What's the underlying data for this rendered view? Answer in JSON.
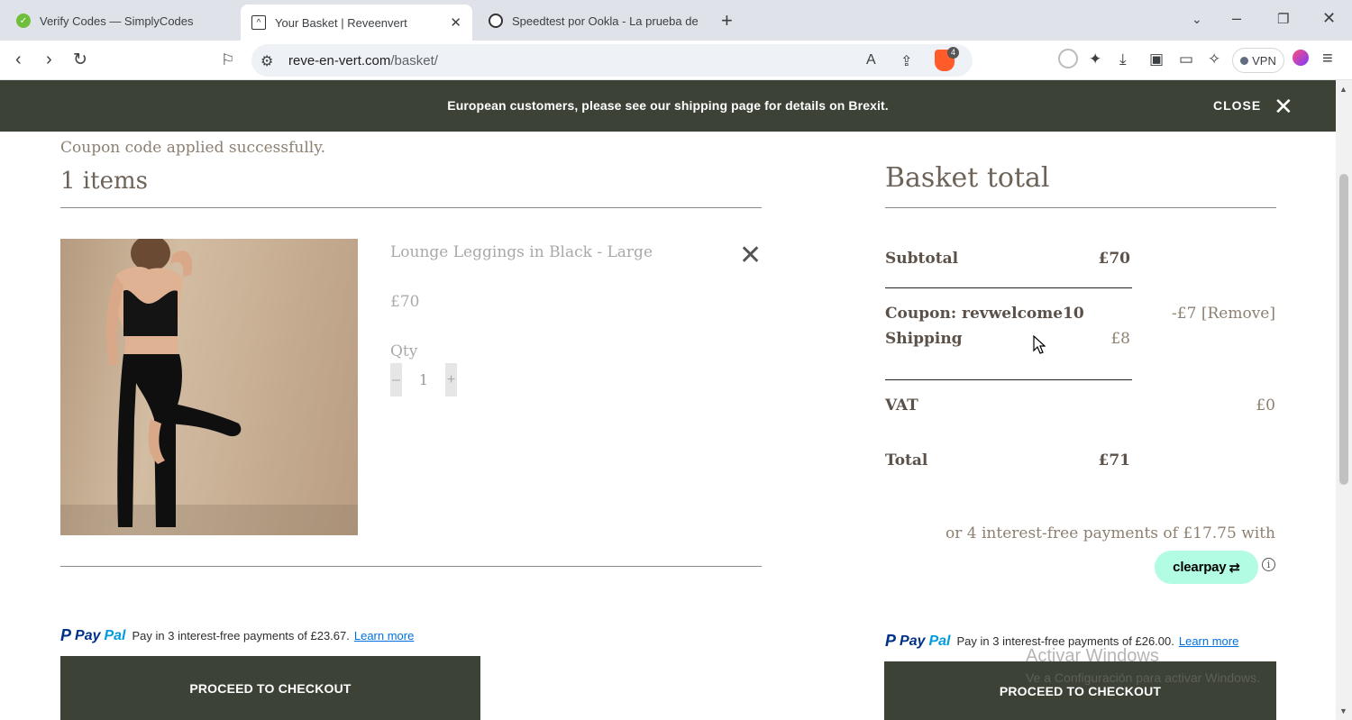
{
  "browser": {
    "tabs": [
      {
        "title": "Verify Codes — SimplyCodes",
        "icon": "simplycodes-favicon"
      },
      {
        "title": "Your Basket | Reveenvert",
        "icon": "reveenvert-favicon",
        "close": "✕"
      },
      {
        "title": "Speedtest por Ookla - La prueba de",
        "icon": "ookla-favicon"
      }
    ],
    "url_host": "reve-en-vert.com",
    "url_path": "/basket/",
    "extension_badge": "4",
    "vpn_label": "VPN"
  },
  "banner": {
    "message": "European customers, please see our shipping page for details on Brexit.",
    "close_label": "CLOSE"
  },
  "basket": {
    "coupon_message": "Coupon code applied successfully.",
    "items_count": "1 items",
    "item": {
      "name": "Lounge Leggings in Black - Large",
      "price": "£70",
      "qty_label": "Qty",
      "qty_minus": "–",
      "qty_value": "1",
      "qty_plus": "+"
    },
    "paypal_left": {
      "text": "Pay in 3 interest-free payments of £23.67.",
      "learn": "Learn more"
    },
    "checkout_label": "PROCEED TO CHECKOUT"
  },
  "summary": {
    "title": "Basket total",
    "subtotal_label": "Subtotal",
    "subtotal_value": "£70",
    "coupon_label": "Coupon: revwelcome10",
    "coupon_value": "-£7",
    "coupon_remove": "[Remove]",
    "shipping_label": "Shipping",
    "shipping_value": "£8",
    "vat_label": "VAT",
    "vat_value": "£0",
    "total_label": "Total",
    "total_value": "£71",
    "clearpay_text": "or 4 interest-free payments of £17.75 with",
    "clearpay_brand": "clearpay",
    "paypal_right": {
      "text": "Pay in 3 interest-free payments of £26.00.",
      "learn": "Learn more"
    },
    "checkout_label": "PROCEED TO CHECKOUT"
  },
  "paypal_brand": {
    "pay": "Pay",
    "pal": "Pal"
  },
  "watermark": {
    "line1": "Activar Windows",
    "line2": "Ve a Configuración para activar Windows."
  },
  "colors": {
    "banner_bg": "#3d4236",
    "button_bg": "#3d4236",
    "clearpay_mint": "#b2fce4",
    "paypal_blue": "#003087",
    "paypal_light": "#009cde"
  }
}
